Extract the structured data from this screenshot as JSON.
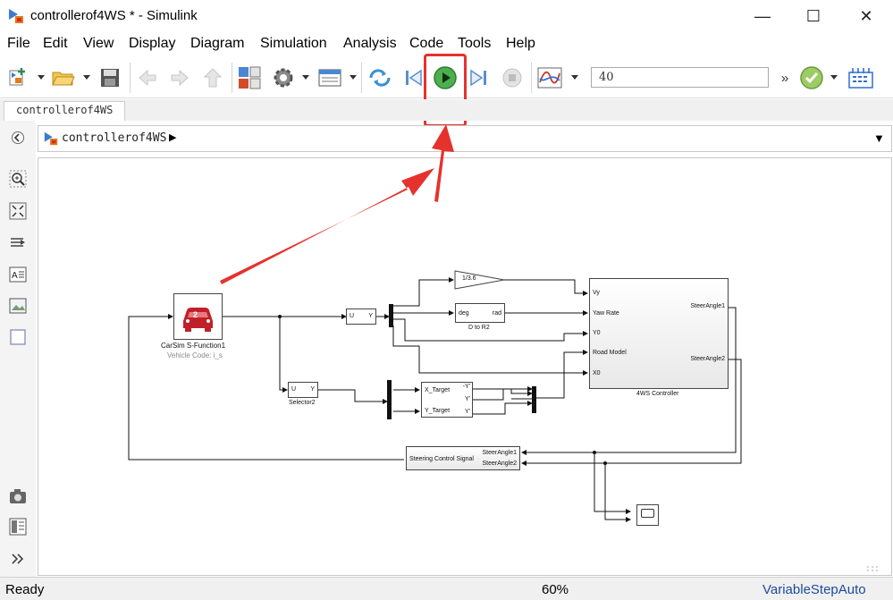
{
  "window": {
    "title": "controllerof4WS * - Simulink",
    "minimize_glyph": "—",
    "maximize_glyph": "☐",
    "close_glyph": "✕"
  },
  "menu": [
    "File",
    "Edit",
    "View",
    "Display",
    "Diagram",
    "Simulation",
    "Analysis",
    "Code",
    "Tools",
    "Help"
  ],
  "toolbar": {
    "stop_time": "40",
    "overflow_glyph": "»",
    "icons": [
      "new-model-icon",
      "open-icon",
      "save-icon",
      "back-icon",
      "forward-icon",
      "up-icon",
      "library-browser-icon",
      "model-config-icon",
      "model-explorer-icon",
      "step-back-icon",
      "run-icon",
      "step-forward-icon",
      "stop-icon",
      "data-inspector-icon",
      "check-icon",
      "build-icon"
    ],
    "highlight_color": "#e5322d"
  },
  "tab": {
    "label": "controllerof4WS"
  },
  "breadcrumb": {
    "label": "controllerof4WS",
    "arrow": "▶",
    "dropdown": "▼"
  },
  "palette": [
    "back-icon",
    "zoom-icon",
    "fit-icon",
    "arrow-icon",
    "annotation-icon",
    "image-icon",
    "area-icon",
    "camera-icon",
    "explorer-bar-icon",
    "expand-icon"
  ],
  "blocks": {
    "carsim": {
      "badge": "2",
      "caption": "CarSim S-Function1",
      "subcaption": "Vehicle Code: i_s",
      "color": "#c0202a"
    },
    "selector1": {
      "in": "U",
      "out": "Y"
    },
    "selector2": {
      "in": "U",
      "out": "Y",
      "caption": "Selector2"
    },
    "gain": {
      "label": "1/3.6"
    },
    "d2r": {
      "in": "deg",
      "out": "rad",
      "caption": "D to R2"
    },
    "controller": {
      "inputs": [
        "Vy",
        "Yaw Rate",
        "Y0",
        "Road Model",
        "X0"
      ],
      "outputs": [
        "SteerAngle1",
        "SteerAngle2"
      ],
      "caption": "4WS Controller"
    },
    "target": {
      "inputs": [
        "X_Target",
        "Y_Target"
      ],
      "outputs": [
        "-Y'",
        "Y'",
        "Y'"
      ]
    },
    "steering": {
      "label": "Steering Control Signal",
      "inputs": [
        "SteerAngle1",
        "SteerAngle2"
      ]
    }
  },
  "status": {
    "left": "Ready",
    "zoom": "60%",
    "solver": "VariableStepAuto"
  }
}
